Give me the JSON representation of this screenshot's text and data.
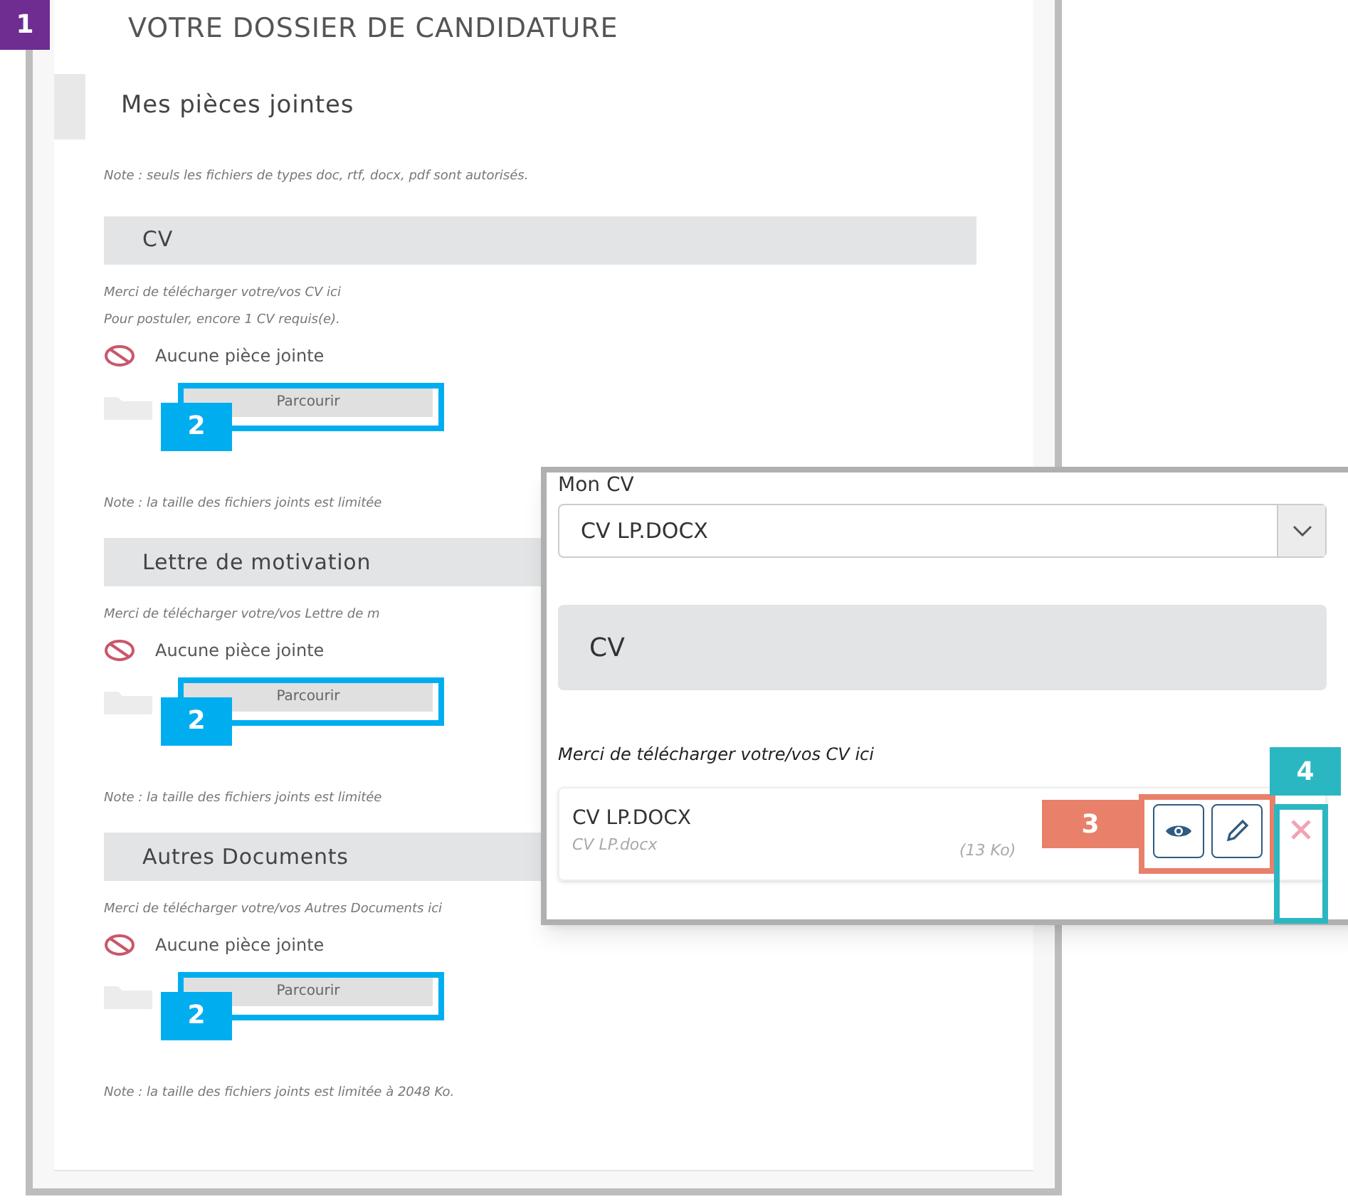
{
  "title": "VOTRE DOSSIER DE CANDIDATURE",
  "title_callout": {
    "label": "1",
    "color": "#6f2c91"
  },
  "tab": "Mes pièces jointes",
  "types_note": "Note : seuls les fichiers de types doc, rtf, docx, pdf sont autorisés.",
  "sections": [
    {
      "heading": "CV",
      "lines": [
        "Merci de télécharger votre/vos CV ici",
        "Pour postuler, encore 1 CV requis(e)."
      ],
      "status": "Aucune pièce jointe",
      "button": "Parcourir",
      "callout": {
        "label": "2",
        "color": "#00aeef"
      },
      "note": "Note : la taille des fichiers joints est limitée"
    },
    {
      "heading": "Lettre de motivation",
      "lines": [
        "Merci de télécharger votre/vos Lettre de m"
      ],
      "status": "Aucune pièce jointe",
      "button": "Parcourir",
      "callout": {
        "label": "2",
        "color": "#00aeef"
      },
      "note": "Note : la taille des fichiers joints est limitée"
    },
    {
      "heading": "Autres Documents",
      "lines": [
        "Merci de télécharger votre/vos Autres Documents ici"
      ],
      "status": "Aucune pièce jointe",
      "button": "Parcourir",
      "callout": {
        "label": "2",
        "color": "#00aeef"
      },
      "note": "Note : la taille des fichiers joints est limitée à 2048 Ko."
    }
  ],
  "popup": {
    "label": "Mon CV",
    "select_value": "CV LP.DOCX",
    "heading": "CV",
    "instruction": "Merci de télécharger votre/vos CV ici",
    "file": {
      "title": "CV LP.DOCX",
      "filename": "CV LP.docx",
      "size": "(13 Ko)"
    },
    "actions_callout": {
      "label": "3",
      "color": "#e8806a"
    },
    "delete_callout": {
      "label": "4",
      "color": "#2bb7c1"
    }
  }
}
